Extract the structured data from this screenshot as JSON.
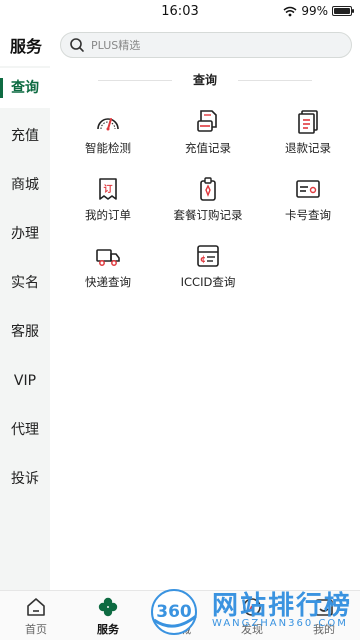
{
  "status_bar": {
    "time": "16:03",
    "battery": "99%",
    "battery_level": 0.99
  },
  "header": {
    "title": "服务",
    "search_placeholder": "PLUS精选"
  },
  "sidebar": {
    "items": [
      {
        "label": "查询",
        "active": true
      },
      {
        "label": "充值"
      },
      {
        "label": "商城"
      },
      {
        "label": "办理"
      },
      {
        "label": "实名"
      },
      {
        "label": "客服"
      },
      {
        "label": "VIP"
      },
      {
        "label": "代理"
      },
      {
        "label": "投诉"
      }
    ]
  },
  "content": {
    "section_title": "查询",
    "items": [
      {
        "label": "智能检测",
        "icon": "gauge-icon"
      },
      {
        "label": "充值记录",
        "icon": "card-record-icon"
      },
      {
        "label": "退款记录",
        "icon": "refund-doc-icon"
      },
      {
        "label": "我的订单",
        "icon": "order-icon"
      },
      {
        "label": "套餐订购记录",
        "icon": "package-tag-icon"
      },
      {
        "label": "卡号查询",
        "icon": "id-card-icon"
      },
      {
        "label": "快递查询",
        "icon": "truck-icon"
      },
      {
        "label": "ICCID查询",
        "icon": "iccid-icon"
      }
    ]
  },
  "bottom_nav": {
    "items": [
      {
        "label": "首页",
        "icon": "home-icon"
      },
      {
        "label": "服务",
        "icon": "clover-icon",
        "active": true
      },
      {
        "label": "商城",
        "icon": "shop-icon"
      },
      {
        "label": "发现",
        "icon": "discover-icon"
      },
      {
        "label": "我的",
        "icon": "mine-icon"
      }
    ]
  },
  "watermark": {
    "brand": "网站排行榜",
    "sub": "WANGZHAN360.COM",
    "logo_text": "360"
  },
  "colors": {
    "accent": "#0e6b42",
    "icon_red": "#e0393e",
    "watermark_blue": "#3a93e0"
  }
}
